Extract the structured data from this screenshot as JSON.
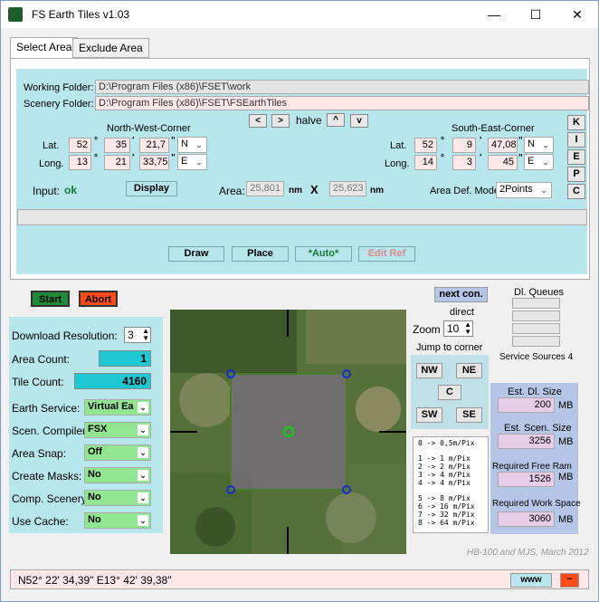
{
  "app": {
    "title": "FS Earth Tiles   v1.03"
  },
  "window_controls": {
    "minimize": "—",
    "maximize": "☐",
    "close": "✕"
  },
  "tabs": [
    {
      "label": "Select Area"
    },
    {
      "label": "Exclude Area"
    }
  ],
  "folders": {
    "working_label": "Working Folder:",
    "working_value": "D:\\Program Files (x86)\\FSET\\work",
    "scenery_label": "Scenery Folder:",
    "scenery_value": "D:\\Program Files (x86)\\FSET\\FSEarthTiles"
  },
  "nav": {
    "prev": "<",
    "next": ">",
    "halve": "halve",
    "up": "^",
    "down": "v"
  },
  "nw": {
    "title": "North-West-Corner",
    "lat_label": "Lat.",
    "lat_deg": "52",
    "lat_min": "35",
    "lat_sec": "21,7",
    "lat_dir": "N",
    "long_label": "Long.",
    "long_deg": "13",
    "long_min": "21",
    "long_sec": "33,75",
    "long_dir": "E"
  },
  "se": {
    "title": "South-East-Corner",
    "lat_label": "Lat.",
    "lat_deg": "52",
    "lat_min": "9",
    "lat_sec": "47,08",
    "lat_dir": "N",
    "long_label": "Long.",
    "long_deg": "14",
    "long_min": "3",
    "long_sec": "45",
    "long_dir": "E"
  },
  "side_buttons": [
    "K",
    "I",
    "E",
    "P",
    "C"
  ],
  "input": {
    "label": "Input:",
    "status": "ok",
    "display_btn": "Display"
  },
  "area": {
    "label": "Area:",
    "width": "25,801",
    "unit1": "nm",
    "x": "X",
    "height": "25,623",
    "unit2": "nm"
  },
  "area_def": {
    "label": "Area Def. Mode:",
    "value": "2Points"
  },
  "actions": {
    "draw": "Draw",
    "place": "Place",
    "auto": "*Auto*",
    "edit_ref": "Edit Ref"
  },
  "start": "Start",
  "abort": "Abort",
  "left": {
    "resolution_label": "Download Resolution:",
    "resolution_value": "3",
    "area_count_label": "Area Count:",
    "area_count": "1",
    "tile_count_label": "Tile Count:",
    "tile_count": "4160",
    "earth_service_label": "Earth Service:",
    "earth_service": "Virtual Ea",
    "compiler_label": "Scen. Compiler:",
    "compiler": "FSX",
    "snap_label": "Area Snap:",
    "snap": "Off",
    "masks_label": "Create Masks:",
    "masks": "No",
    "comp_label": "Comp. Scenery:",
    "comp": "No",
    "cache_label": "Use Cache:",
    "cache": "No"
  },
  "next_con": "next con.",
  "direct": "direct",
  "zoom": {
    "label": "Zoom",
    "value": "10"
  },
  "jump": {
    "label": "Jump to corner",
    "nw": "NW",
    "ne": "NE",
    "c": "C",
    "sw": "SW",
    "se": "SE"
  },
  "scale": [
    "0 -> 0,5m/Pix",
    "1 ->   1 m/Pix",
    "2 ->   2 m/Pix",
    "3 ->   4 m/Pix",
    "4 ->   4 m/Pix",
    "5 ->   8 m/Pix",
    "6 -> 16 m/Pix",
    "7 -> 32 m/Pix",
    "8 -> 64 m/Pix"
  ],
  "queues": {
    "label": "Dl. Queues",
    "sources": "Service Sources 4"
  },
  "right": {
    "dl_size_label": "Est. Dl. Size",
    "dl_size": "200",
    "dl_unit": "MB",
    "scen_size_label": "Est. Scen. Size",
    "scen_size": "3256",
    "scen_unit": "MB",
    "ram_label": "Required Free Ram",
    "ram": "1526",
    "ram_unit": "MB",
    "work_label": "Required Work Space",
    "work": "3060",
    "work_unit": "MB"
  },
  "credit": "HB-100 and MJS, March 2012",
  "status": {
    "coords": "N52° 22' 34,39\"    E13° 42' 39,38\"",
    "www": "www",
    "tilde": "~"
  }
}
